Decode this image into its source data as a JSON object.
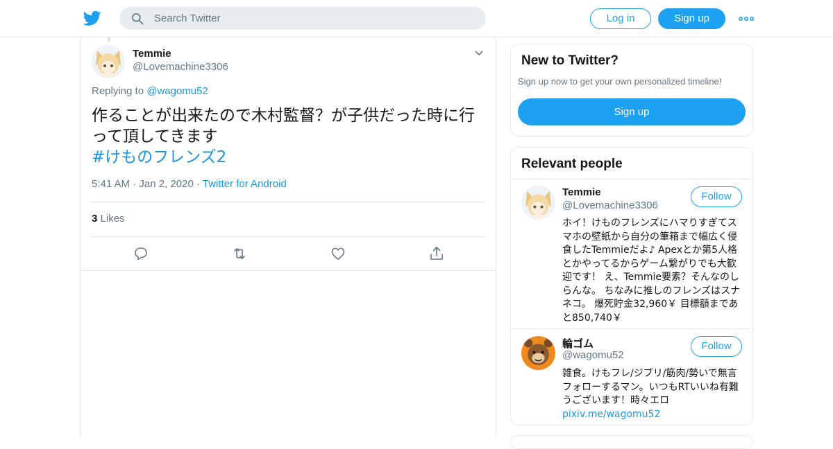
{
  "header": {
    "search_placeholder": "Search Twitter",
    "login_label": "Log in",
    "signup_label": "Sign up",
    "brand_color": "#1da1f2"
  },
  "tweet": {
    "author_name": "Temmie",
    "author_handle": "@Lovemachine3306",
    "replying_prefix": "Replying to",
    "replying_to": "@wagomu52",
    "text": "作ることが出来たので木村監督？が子供だった時に行って頂してきます",
    "hashtag": "#けものフレンズ2",
    "time": "5:41 AM",
    "date": "Jan 2, 2020",
    "source": "Twitter for Android",
    "likes_count": "3",
    "likes_label": "Likes"
  },
  "sidebar": {
    "new_title": "New to Twitter?",
    "new_desc": "Sign up now to get your own personalized timeline!",
    "new_signup_label": "Sign up",
    "relevant_title": "Relevant people",
    "people": [
      {
        "name": "Temmie",
        "handle": "@Lovemachine3306",
        "follow_label": "Follow",
        "bio": "ホイ！けものフレンズにハマりすぎてスマホの壁紙から自分の筆箱まで幅広く侵食したTemmieだよ♪ Apexとか第5人格とかやってるからゲーム繋がりでも大歓迎です！ え、Temmie要素？そんなのしらんな。 ちなみに推しのフレンズはスナネコ。 爆死貯金32,960￥ 目標額まであと850,740￥"
      },
      {
        "name": "輪ゴム",
        "handle": "@wagomu52",
        "follow_label": "Follow",
        "bio": "雑食。けもフレ/ジブリ/筋肉/勢いで無言フォローするマン。いつもRTいいね有難うございます！時々エロ",
        "bio_link": "pixiv.me/wagomu52"
      }
    ]
  }
}
